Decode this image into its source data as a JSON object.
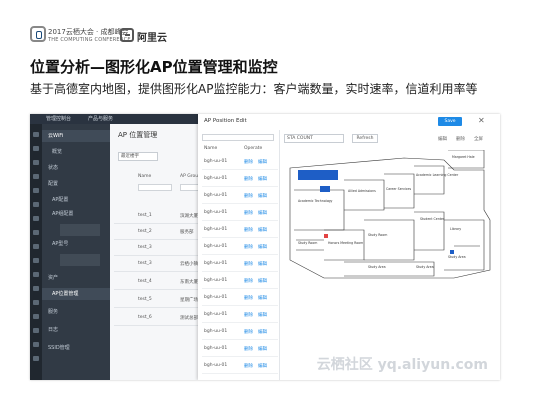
{
  "header": {
    "conference_title": "2017云栖大会 · 成都峰会",
    "conference_subtitle": "THE COMPUTING CONFERENCE",
    "brand": "阿里云"
  },
  "slide": {
    "title": "位置分析—图形化AP位置管理和监控",
    "subtitle": "基于高德室内地图，提供图形化AP监控能力：客户端数量，实时速率，信道利用率等"
  },
  "app": {
    "topbar_items": [
      "管理控制台",
      "产品与服务"
    ],
    "nav": [
      {
        "label": "云WiFi",
        "active": true
      },
      {
        "label": "概览",
        "active": false
      },
      {
        "label": "状态",
        "active": false
      },
      {
        "label": "配置",
        "active": false
      },
      {
        "label": "AP配置",
        "active": false
      },
      {
        "label": "AP组配置",
        "active": false
      },
      {
        "label": "AP型号",
        "active": false
      },
      {
        "label": "资产",
        "active": false
      },
      {
        "label": "AP位置管理",
        "active": true
      },
      {
        "label": "服务",
        "active": false
      },
      {
        "label": "日志",
        "active": false
      },
      {
        "label": "SSID管理",
        "active": false
      }
    ],
    "content_title": "AP 位置管理",
    "filter_label": "最近楼宇",
    "table_headers": [
      "Name",
      "AP Group Name",
      "Floor"
    ],
    "table_rows": [
      {
        "name": "test_1",
        "group": "滨湖大厦"
      },
      {
        "name": "test_2",
        "group": "服务部"
      },
      {
        "name": "test_3",
        "group": ""
      },
      {
        "name": "test_3",
        "group": "云栖小镇"
      },
      {
        "name": "test_4",
        "group": "东南大厦"
      },
      {
        "name": "test_5",
        "group": "星期广场"
      },
      {
        "name": "test_6",
        "group": "测试总部"
      }
    ]
  },
  "dialog": {
    "title": "AP Position Edit",
    "save_label": "Save",
    "close_label": "✕",
    "list_headers": [
      "Name",
      "Operate"
    ],
    "ap_rows": [
      {
        "name": "bgh-uu-01",
        "op1": "删除",
        "op2": "编辑"
      },
      {
        "name": "bgh-uu-01",
        "op1": "删除",
        "op2": "编辑"
      },
      {
        "name": "bgh-uu-01",
        "op1": "删除",
        "op2": "编辑"
      },
      {
        "name": "bgh-uu-01",
        "op1": "删除",
        "op2": "编辑"
      },
      {
        "name": "bgh-uu-01",
        "op1": "删除",
        "op2": "编辑"
      },
      {
        "name": "bgh-uu-01",
        "op1": "删除",
        "op2": "编辑"
      },
      {
        "name": "bgh-uu-01",
        "op1": "删除",
        "op2": "编辑"
      },
      {
        "name": "bgh-uu-01",
        "op1": "删除",
        "op2": "编辑"
      },
      {
        "name": "bgh-uu-01",
        "op1": "删除",
        "op2": "编辑"
      },
      {
        "name": "bgh-uu-01",
        "op1": "删除",
        "op2": "编辑"
      },
      {
        "name": "bgh-uu-01",
        "op1": "删除",
        "op2": "编辑"
      },
      {
        "name": "bgh-uu-01",
        "op1": "删除",
        "op2": "编辑"
      },
      {
        "name": "bgh-uu-01",
        "op1": "删除",
        "op2": "编辑"
      }
    ],
    "sta_select": "STA COUNT",
    "refresh_label": "Refresh",
    "tools": [
      "编辑",
      "删除",
      "全屏"
    ],
    "rooms": [
      "Margaret Hale",
      "Academic Learning Center",
      "Career Services",
      "Allied Admissions",
      "Student Center",
      "Academic Technology",
      "Honors Meeting Room",
      "Study Area",
      "Study Area",
      "Library",
      "Study Room",
      "Study Room",
      "Study Area"
    ]
  },
  "watermark": "云栖社区 yq.aliyun.com"
}
